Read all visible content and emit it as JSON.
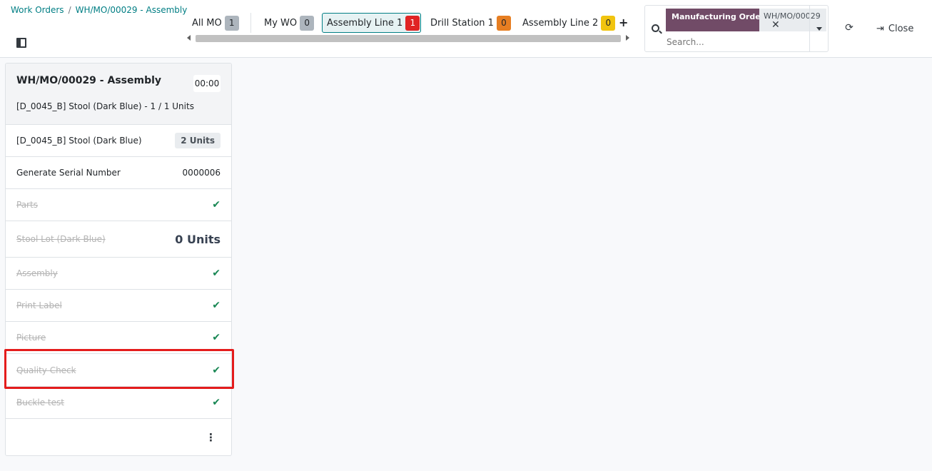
{
  "breadcrumb": {
    "items": [
      "Work Orders",
      "WH/MO/00029 - Assembly"
    ],
    "separator": "/"
  },
  "tabs": [
    {
      "label": "All MO",
      "count": "1",
      "badge_color": "#adb5bd",
      "badge_text": "#212529"
    },
    {
      "label": "My WO",
      "count": "0",
      "badge_color": "#adb5bd",
      "badge_text": "#212529"
    },
    {
      "label": "Assembly Line 1",
      "count": "1",
      "badge_color": "#e02424",
      "badge_text": "#ffffff",
      "active": true
    },
    {
      "label": "Drill Station 1",
      "count": "0",
      "badge_color": "#e67e22",
      "badge_text": "#212529"
    },
    {
      "label": "Assembly Line 2",
      "count": "0",
      "badge_color": "#f1c40f",
      "badge_text": "#212529"
    }
  ],
  "add_tab_icon": "+",
  "search": {
    "facet_label": "Manufacturing Order",
    "facet_value": "WH/MO/00029",
    "remove_icon": "✕",
    "placeholder": "Search..."
  },
  "toolbar": {
    "refresh_icon": "⟳",
    "close_label": "Close",
    "close_icon": "⇥"
  },
  "card": {
    "title": "WH/MO/00029 - Assembly",
    "timer": "00:00",
    "subtitle": "[D_0045_B] Stool (Dark Blue) - 1 / 1 Units",
    "rows": [
      {
        "label": "[D_0045_B] Stool (Dark Blue)",
        "value": "2 Units",
        "kind": "badge"
      },
      {
        "label": "Generate Serial Number",
        "value": "0000006",
        "kind": "text"
      },
      {
        "label": "Parts",
        "value": "✔",
        "kind": "check",
        "done": true
      },
      {
        "label": "Stool Lot (Dark Blue)",
        "value": "0 Units",
        "kind": "big",
        "done": true
      },
      {
        "label": "Assembly",
        "value": "✔",
        "kind": "check",
        "done": true
      },
      {
        "label": "Print Label",
        "value": "✔",
        "kind": "check",
        "done": true
      },
      {
        "label": "Picture",
        "value": "✔",
        "kind": "check",
        "done": true
      },
      {
        "label": "Quality Check",
        "value": "✔",
        "kind": "check",
        "done": true
      },
      {
        "label": "Buckle test",
        "value": "✔",
        "kind": "check",
        "done": true
      }
    ],
    "menu_icon": "⋮"
  },
  "colors": {
    "accent": "#017e84",
    "brand": "#714b67",
    "check": "#198754",
    "highlight": "#e41c1c"
  }
}
